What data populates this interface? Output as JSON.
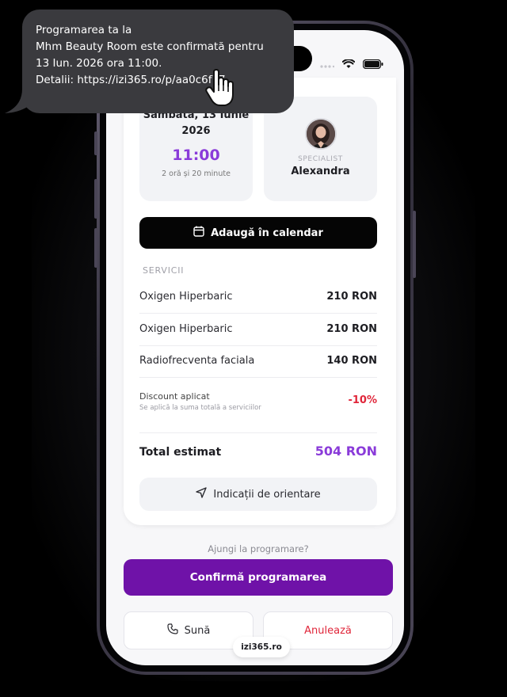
{
  "sms": {
    "line1": "Programarea ta la",
    "line2": "Mhm Beauty Room este confirmată pentru",
    "line3": "13 Iun. 2026 ora 11:00.",
    "line4": "Detalii: https://izi365.ro/p/aa0c6f77"
  },
  "appointment": {
    "date_line1": "Sâmbătă, 13 Iunie",
    "date_line2": "2026",
    "time": "11:00",
    "duration": "2 oră și 20 minute"
  },
  "specialist": {
    "label": "SPECIALIST",
    "name": "Alexandra"
  },
  "calendar_button": "Adaugă în calendar",
  "services_label": "SERVICII",
  "services": [
    {
      "name": "Oxigen Hiperbaric",
      "price": "210 RON"
    },
    {
      "name": "Oxigen Hiperbaric",
      "price": "210 RON"
    },
    {
      "name": "Radiofrecventa faciala",
      "price": "140 RON"
    }
  ],
  "discount": {
    "title": "Discount aplicat",
    "subtitle": "Se aplică la suma totală a serviciilor",
    "value": "-10%"
  },
  "total": {
    "label": "Total estimat",
    "value": "504 RON"
  },
  "directions_button": "Indicații de orientare",
  "question": "Ajungi la programare?",
  "confirm_button": "Confirmă programarea",
  "call_button": "Sună",
  "cancel_button": "Anulează",
  "domain": "izi365.ro",
  "colors": {
    "accent": "#8a3bd9",
    "confirm": "#6f12a8",
    "danger": "#e0263a"
  }
}
